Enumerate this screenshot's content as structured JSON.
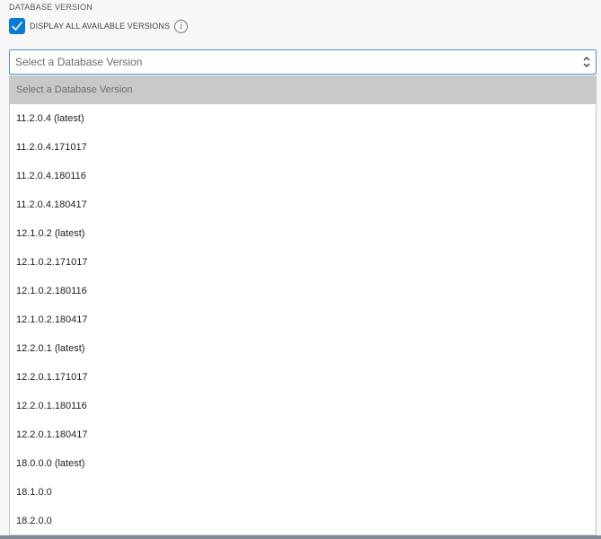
{
  "section": {
    "label": "DATABASE VERSION"
  },
  "checkbox": {
    "label": "DISPLAY ALL AVAILABLE VERSIONS",
    "checked": true,
    "accent_color": "#0a7bd4"
  },
  "info_icon": {
    "glyph": "i"
  },
  "select": {
    "current_value": "Select a Database Version",
    "border_color": "#4a90d9"
  },
  "dropdown": {
    "placeholder": "Select a Database Version",
    "options": [
      "11.2.0.4 (latest)",
      "11.2.0.4.171017",
      "11.2.0.4.180116",
      "11.2.0.4.180417",
      "12.1.0.2 (latest)",
      "12.1.0.2.171017",
      "12.1.0.2.180116",
      "12.1.0.2.180417",
      "12.2.0.1 (latest)",
      "12.2.0.1.171017",
      "12.2.0.1.180116",
      "12.2.0.1.180417",
      "18.0.0.0 (latest)",
      "18.1.0.0",
      "18.2.0.0"
    ]
  }
}
